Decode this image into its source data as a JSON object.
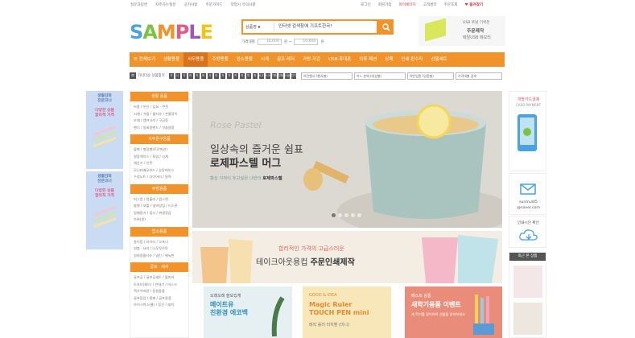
{
  "top_left_links": [
    "질문과답변",
    "자주하는질문",
    "공지사항",
    "주문가이드",
    "작업시 유의사항"
  ],
  "top_right_links": [
    "로그인",
    "회원가입",
    "마이페이지",
    "고객센터",
    "주문조회"
  ],
  "favorites": "즐겨찾기",
  "logo_letters": [
    "S",
    "A",
    "M",
    "P",
    "L",
    "E"
  ],
  "logo_colors": [
    "#4aa3df",
    "#7cc242",
    "#f0932b",
    "#e05b8c",
    "#9b59b6",
    "#f1c40f"
  ],
  "search": {
    "category": "상품명",
    "value": "인터넷 검색창에 기프트한국!"
  },
  "price_filter": {
    "label": "가격대별",
    "from": "10,000",
    "unit1": "원 ~",
    "to": "10,000",
    "unit2": "원"
  },
  "top_banner": {
    "line1": "USB 토탈 기획전",
    "line2": "주문제작",
    "line3": "메탈USB 메모리"
  },
  "nav": {
    "all_label": "전체보기",
    "items": [
      "생활용품",
      "사무용품",
      "주방용품",
      "업소용품",
      "시계",
      "골프·레저",
      "가방·지갑",
      "USB·휴대폰",
      "의류·패션",
      "상패",
      "인쇄·판수작",
      "선물세트"
    ]
  },
  "filterbar": {
    "label": "가나다순 상품찾기",
    "letters": [
      "가",
      "나",
      "다",
      "라",
      "마",
      "바",
      "사",
      "아",
      "자",
      "차",
      "카",
      "타",
      "파",
      "하",
      "A-Z",
      "0-9",
      "기타",
      "전체",
      "신상",
      "인기"
    ],
    "selects": [
      "어린행사 (행사별)",
      "어느 분께 (대상별)",
      "어떤업종 (업종별)",
      "가격대별 검색"
    ]
  },
  "side_ads": [
    {
      "line1": "생활감화\n전문코너",
      "line2": "다양한 상품\n합리적 가격"
    },
    {
      "line1": "생활감화\n전문코너",
      "line2": "다양한 상품\n합리적 가격"
    }
  ],
  "categories": [
    {
      "head": "생활 용품",
      "items": [
        "타올 / 우산 / 담요 · 쿠션",
        "시계 / 거울 / 물티슈 / 손톱깎이",
        "부채 / 캠프고리 / 구급함",
        "핸디 / 일회용밴드 / 칫솔용품"
      ]
    },
    {
      "head": "사무문구용품",
      "items": [
        "볼펜 / 형광펜(트로피안)",
        "명함케이스 / 화일 / 시계",
        "계산기 / 인주",
        "모니터메모보드 / 상장케이스",
        "수첩노트 / 다이어리 / 달력"
      ]
    },
    {
      "head": "주방용품",
      "items": [
        "머그컵 / 텀블러 / 컵스텐",
        "물병 / 보틀 / 냉비방립 / 티스푼",
        "밀폐용기 / 접시 / 위생장갑",
        "가위(칼)"
      ]
    },
    {
      "head": "업소용품",
      "items": [
        "종이컵 / 라이터 / 오프너",
        "연봉 · 요지 / 나무젓가락",
        "일회용물티슈 / 냅킨 / 메뉴판"
      ]
    },
    {
      "head": "골프 · 레저",
      "items": [
        "골프공 / 골프공세트 / 볼마커",
        "토자티(헤드) / 안테기 / 마스크",
        "맥가이버칼 / 응원용품",
        "골프장갑 / 팔찌 / 골프용품",
        "아이스박스(쿨) / 등산 / 레져"
      ]
    }
  ],
  "hero": {
    "script": "Rose Pastel",
    "title1": "일상속의 즐거운 쉼표",
    "title2": "로제파스텔 머그",
    "sub_a": "항상 가까이 두고싶은 나만의 ",
    "sub_b": "로제파스텔"
  },
  "promo": {
    "line1": "합리적인 가격의 고급스러운",
    "line2a": "테이크아웃용컵 ",
    "line2b": "주문인쇄제작"
  },
  "cards": [
    {
      "sub": "오래오래 쓸모있게",
      "title": "메이트유\n친환경 에코백",
      "bg": "#e6f0f2",
      "color": "#2b8fbf"
    },
    {
      "sub": "GOOD & IDEA",
      "title": "Magic Ruler\nTOUCH PEN mini",
      "bg": "#f7e7b9",
      "color": "#e88a2b"
    },
    {
      "sub": "베스트 상품",
      "title": "새학기용품 이벤트",
      "bg": "#e98d7a",
      "color": "#ffffff"
    }
  ],
  "card_extra": {
    "card2_line": "매직 룰러 터치펜 (미니)",
    "card3_line": "새 학기를 맞이하여 선물을 준비하세요"
  },
  "right_ad": {
    "title": "개별카드결제",
    "sub": "CARD PAYMENT"
  },
  "email": {
    "line1": "sunmul45",
    "line2": "@naver.com"
  },
  "tax": {
    "label": "인쇄시안 확인"
  },
  "recent": {
    "head": "최근 본 상품"
  }
}
